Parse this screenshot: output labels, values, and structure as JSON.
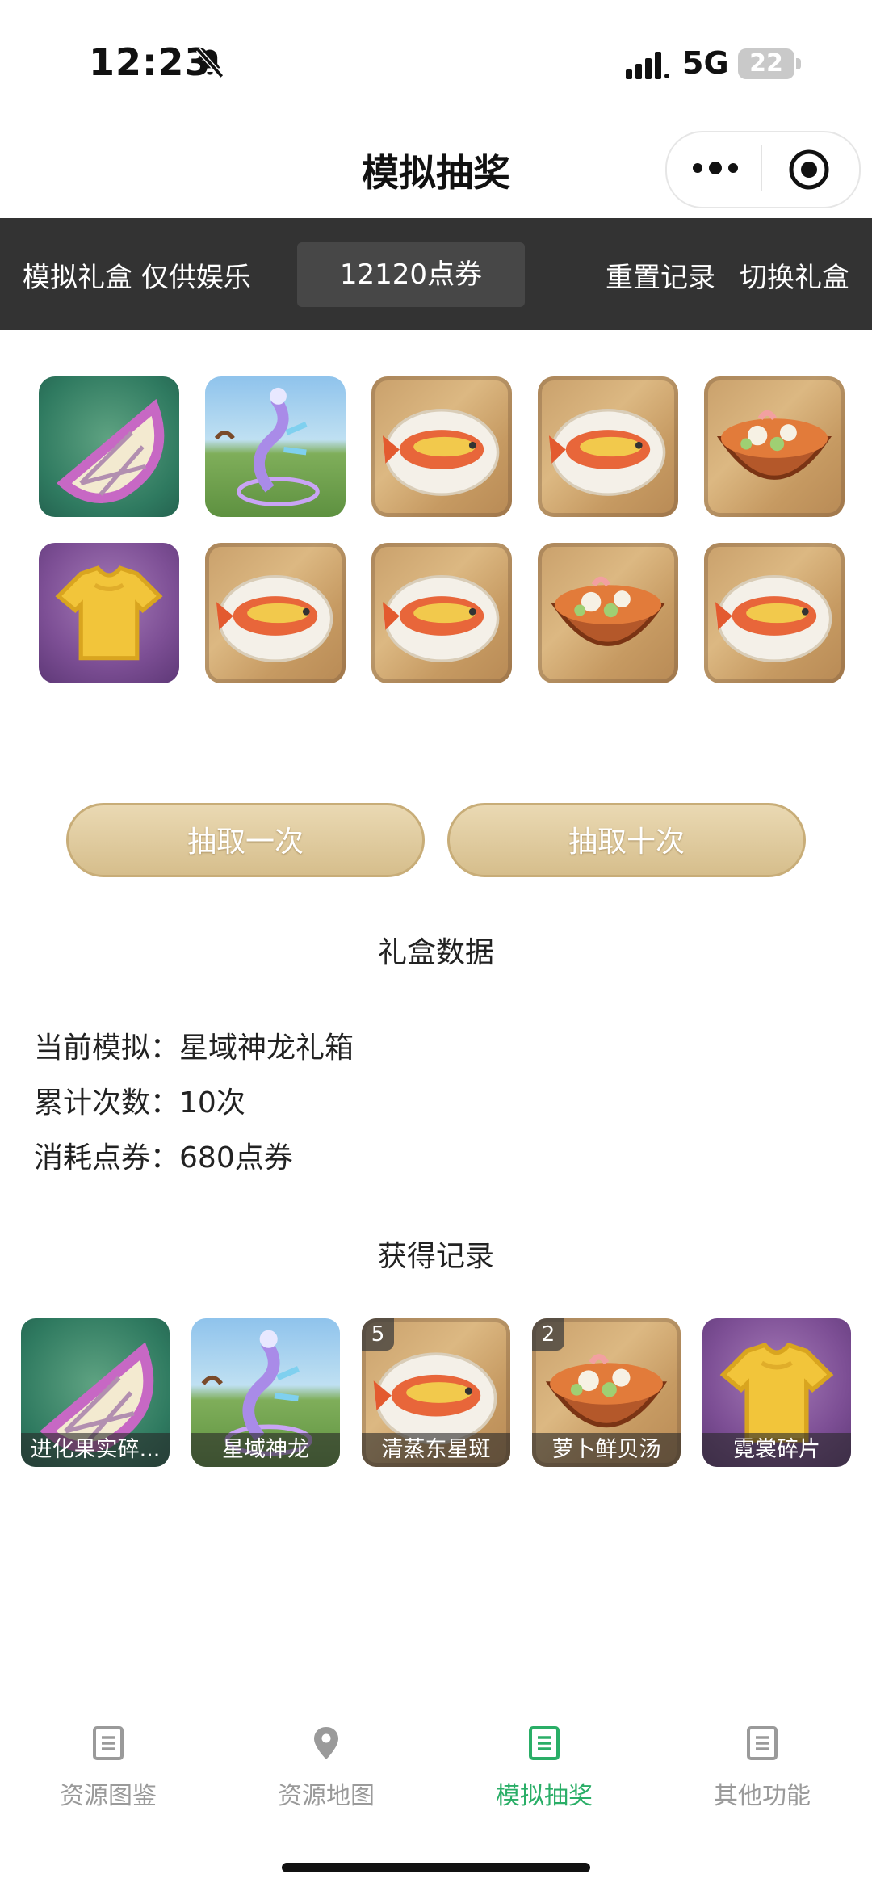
{
  "status_bar": {
    "time": "12:23",
    "network": "5G",
    "battery": "22"
  },
  "nav": {
    "title": "模拟抽奖"
  },
  "topbar": {
    "left_label": "模拟礼盒 仅供娱乐",
    "points": "12120点券",
    "reset_label": "重置记录",
    "switch_label": "切换礼盒"
  },
  "grid": [
    {
      "kind": "fruit"
    },
    {
      "kind": "dragon"
    },
    {
      "kind": "fish"
    },
    {
      "kind": "fish"
    },
    {
      "kind": "soup"
    },
    {
      "kind": "shirt"
    },
    {
      "kind": "fish"
    },
    {
      "kind": "fish"
    },
    {
      "kind": "soup"
    },
    {
      "kind": "fish"
    }
  ],
  "buttons": {
    "draw_once": "抽取一次",
    "draw_ten": "抽取十次"
  },
  "stats": {
    "section_title": "礼盒数据",
    "current_label": "当前模拟：",
    "current_value": "星域神龙礼箱",
    "count_label": "累计次数：",
    "count_value": "10次",
    "cost_label": "消耗点券：",
    "cost_value": "680点券"
  },
  "records": {
    "section_title": "获得记录",
    "items": [
      {
        "name": "进化果实碎...",
        "kind": "fruit",
        "count": ""
      },
      {
        "name": "星域神龙",
        "kind": "dragon",
        "count": ""
      },
      {
        "name": "清蒸东星斑",
        "kind": "fish",
        "count": "5"
      },
      {
        "name": "萝卜鲜贝汤",
        "kind": "soup",
        "count": "2"
      },
      {
        "name": "霓裳碎片",
        "kind": "shirt",
        "count": ""
      }
    ]
  },
  "tabs": [
    {
      "label": "资源图鉴",
      "icon": "document-icon"
    },
    {
      "label": "资源地图",
      "icon": "map-pin-icon"
    },
    {
      "label": "模拟抽奖",
      "icon": "document-icon"
    },
    {
      "label": "其他功能",
      "icon": "document-icon"
    }
  ],
  "colors": {
    "accent": "#2aae67",
    "topbar": "#333333",
    "button_gold": "#d6be8c"
  }
}
